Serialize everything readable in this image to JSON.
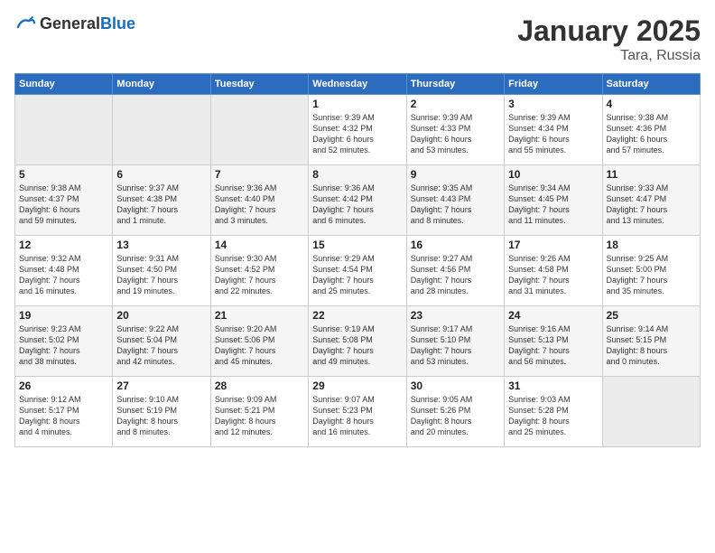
{
  "header": {
    "logo_general": "General",
    "logo_blue": "Blue",
    "month": "January 2025",
    "location": "Tara, Russia"
  },
  "days_of_week": [
    "Sunday",
    "Monday",
    "Tuesday",
    "Wednesday",
    "Thursday",
    "Friday",
    "Saturday"
  ],
  "weeks": [
    [
      {
        "day": "",
        "info": ""
      },
      {
        "day": "",
        "info": ""
      },
      {
        "day": "",
        "info": ""
      },
      {
        "day": "1",
        "info": "Sunrise: 9:39 AM\nSunset: 4:32 PM\nDaylight: 6 hours\nand 52 minutes."
      },
      {
        "day": "2",
        "info": "Sunrise: 9:39 AM\nSunset: 4:33 PM\nDaylight: 6 hours\nand 53 minutes."
      },
      {
        "day": "3",
        "info": "Sunrise: 9:39 AM\nSunset: 4:34 PM\nDaylight: 6 hours\nand 55 minutes."
      },
      {
        "day": "4",
        "info": "Sunrise: 9:38 AM\nSunset: 4:36 PM\nDaylight: 6 hours\nand 57 minutes."
      }
    ],
    [
      {
        "day": "5",
        "info": "Sunrise: 9:38 AM\nSunset: 4:37 PM\nDaylight: 6 hours\nand 59 minutes."
      },
      {
        "day": "6",
        "info": "Sunrise: 9:37 AM\nSunset: 4:38 PM\nDaylight: 7 hours\nand 1 minute."
      },
      {
        "day": "7",
        "info": "Sunrise: 9:36 AM\nSunset: 4:40 PM\nDaylight: 7 hours\nand 3 minutes."
      },
      {
        "day": "8",
        "info": "Sunrise: 9:36 AM\nSunset: 4:42 PM\nDaylight: 7 hours\nand 6 minutes."
      },
      {
        "day": "9",
        "info": "Sunrise: 9:35 AM\nSunset: 4:43 PM\nDaylight: 7 hours\nand 8 minutes."
      },
      {
        "day": "10",
        "info": "Sunrise: 9:34 AM\nSunset: 4:45 PM\nDaylight: 7 hours\nand 11 minutes."
      },
      {
        "day": "11",
        "info": "Sunrise: 9:33 AM\nSunset: 4:47 PM\nDaylight: 7 hours\nand 13 minutes."
      }
    ],
    [
      {
        "day": "12",
        "info": "Sunrise: 9:32 AM\nSunset: 4:48 PM\nDaylight: 7 hours\nand 16 minutes."
      },
      {
        "day": "13",
        "info": "Sunrise: 9:31 AM\nSunset: 4:50 PM\nDaylight: 7 hours\nand 19 minutes."
      },
      {
        "day": "14",
        "info": "Sunrise: 9:30 AM\nSunset: 4:52 PM\nDaylight: 7 hours\nand 22 minutes."
      },
      {
        "day": "15",
        "info": "Sunrise: 9:29 AM\nSunset: 4:54 PM\nDaylight: 7 hours\nand 25 minutes."
      },
      {
        "day": "16",
        "info": "Sunrise: 9:27 AM\nSunset: 4:56 PM\nDaylight: 7 hours\nand 28 minutes."
      },
      {
        "day": "17",
        "info": "Sunrise: 9:26 AM\nSunset: 4:58 PM\nDaylight: 7 hours\nand 31 minutes."
      },
      {
        "day": "18",
        "info": "Sunrise: 9:25 AM\nSunset: 5:00 PM\nDaylight: 7 hours\nand 35 minutes."
      }
    ],
    [
      {
        "day": "19",
        "info": "Sunrise: 9:23 AM\nSunset: 5:02 PM\nDaylight: 7 hours\nand 38 minutes."
      },
      {
        "day": "20",
        "info": "Sunrise: 9:22 AM\nSunset: 5:04 PM\nDaylight: 7 hours\nand 42 minutes."
      },
      {
        "day": "21",
        "info": "Sunrise: 9:20 AM\nSunset: 5:06 PM\nDaylight: 7 hours\nand 45 minutes."
      },
      {
        "day": "22",
        "info": "Sunrise: 9:19 AM\nSunset: 5:08 PM\nDaylight: 7 hours\nand 49 minutes."
      },
      {
        "day": "23",
        "info": "Sunrise: 9:17 AM\nSunset: 5:10 PM\nDaylight: 7 hours\nand 53 minutes."
      },
      {
        "day": "24",
        "info": "Sunrise: 9:16 AM\nSunset: 5:13 PM\nDaylight: 7 hours\nand 56 minutes."
      },
      {
        "day": "25",
        "info": "Sunrise: 9:14 AM\nSunset: 5:15 PM\nDaylight: 8 hours\nand 0 minutes."
      }
    ],
    [
      {
        "day": "26",
        "info": "Sunrise: 9:12 AM\nSunset: 5:17 PM\nDaylight: 8 hours\nand 4 minutes."
      },
      {
        "day": "27",
        "info": "Sunrise: 9:10 AM\nSunset: 5:19 PM\nDaylight: 8 hours\nand 8 minutes."
      },
      {
        "day": "28",
        "info": "Sunrise: 9:09 AM\nSunset: 5:21 PM\nDaylight: 8 hours\nand 12 minutes."
      },
      {
        "day": "29",
        "info": "Sunrise: 9:07 AM\nSunset: 5:23 PM\nDaylight: 8 hours\nand 16 minutes."
      },
      {
        "day": "30",
        "info": "Sunrise: 9:05 AM\nSunset: 5:26 PM\nDaylight: 8 hours\nand 20 minutes."
      },
      {
        "day": "31",
        "info": "Sunrise: 9:03 AM\nSunset: 5:28 PM\nDaylight: 8 hours\nand 25 minutes."
      },
      {
        "day": "",
        "info": ""
      }
    ]
  ]
}
